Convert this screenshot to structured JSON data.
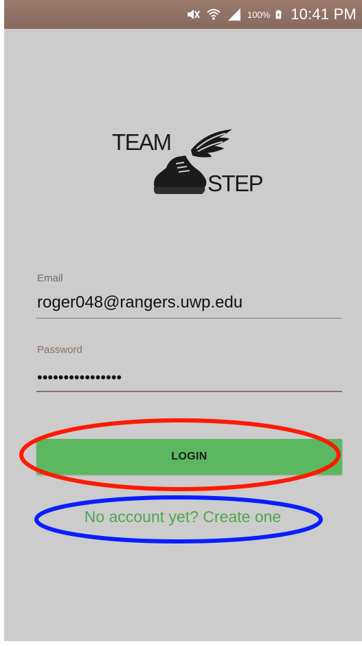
{
  "status_bar": {
    "battery_percent": "100%",
    "time": "10:41 PM",
    "icons": [
      "mute-icon",
      "wifi-icon",
      "signal-icon",
      "battery-charging-icon"
    ]
  },
  "logo": {
    "word_top": "TEAM",
    "word_bottom": "STEP",
    "art": "winged-shoe-icon"
  },
  "form": {
    "email_label": "Email",
    "email_value": "roger048@rangers.uwp.edu",
    "password_label": "Password",
    "password_mask": "••••••••••••••••"
  },
  "actions": {
    "login_label": "LOGIN",
    "create_account_label": "No account yet? Create one"
  },
  "annotations": {
    "red_ellipse_color": "#ff1a00",
    "blue_ellipse_color": "#0a1eff"
  },
  "colors": {
    "status_bar": "#8d6e63",
    "background": "#cccccc",
    "accent_green": "#5cb860",
    "link_green": "#4fa84f",
    "password_accent": "#8d6e63"
  }
}
